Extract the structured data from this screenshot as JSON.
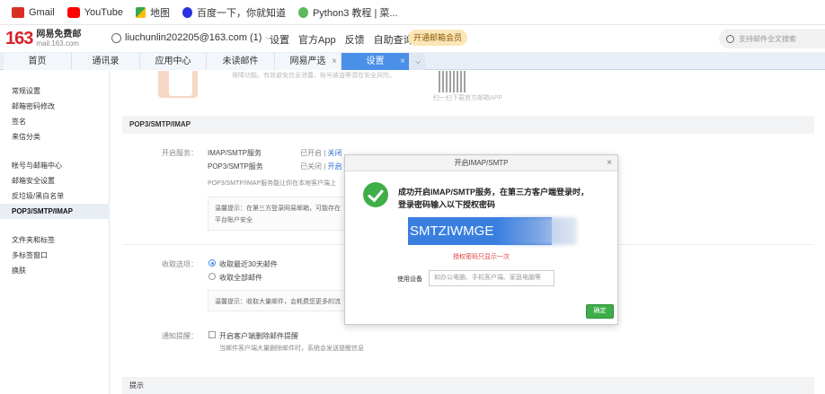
{
  "bookmarks": [
    {
      "label": "Gmail",
      "icon": "gmail-icon",
      "color": "#d93025"
    },
    {
      "label": "YouTube",
      "icon": "youtube-icon",
      "color": "#ff0000"
    },
    {
      "label": "地图",
      "icon": "maps-icon",
      "color": "#34a853"
    },
    {
      "label": "百度一下，你就知道",
      "icon": "baidu-icon",
      "color": "#2932e1"
    },
    {
      "label": "Python3 教程 | 菜...",
      "icon": "runoob-icon",
      "color": "#5cb85c"
    }
  ],
  "header": {
    "logo_number": "163",
    "logo_title": "网易免费邮",
    "logo_domain": "mail.163.com",
    "account": "liuchunlin202205@163.com (1)",
    "links": [
      "设置",
      "官方App",
      "反馈",
      "自助查询"
    ],
    "vip": "开通邮箱会员",
    "search_placeholder": "支持邮件全文搜索"
  },
  "tabs": [
    {
      "label": "首页",
      "closable": false,
      "active": false
    },
    {
      "label": "通讯录",
      "closable": false,
      "active": false
    },
    {
      "label": "应用中心",
      "closable": false,
      "active": false
    },
    {
      "label": "未读邮件",
      "closable": false,
      "active": false
    },
    {
      "label": "网易严选",
      "closable": true,
      "active": false
    },
    {
      "label": "设置",
      "closable": true,
      "active": true
    }
  ],
  "sidebar": {
    "items": [
      "常规设置",
      "邮箱密码修改",
      "签名",
      "来信分类",
      "帐号与邮箱中心",
      "邮箱安全设置",
      "反垃圾/黑白名单",
      "POP3/SMTP/IMAP",
      "文件夹和标签",
      "多标签窗口",
      "换肤"
    ],
    "active": "POP3/SMTP/IMAP"
  },
  "main": {
    "top_gray_text": "保障功能。有效避免信息泄露，账号被盗等潜在安全风险。",
    "qr_caption": "扫一扫下载官方邮箱APP",
    "section_title": "POP3/SMTP/IMAP",
    "service_label": "开启服务：",
    "services": [
      {
        "name": "IMAP/SMTP服务",
        "status": "已开启",
        "action": "关闭"
      },
      {
        "name": "POP3/SMTP服务",
        "status": "已关闭",
        "action": "开启"
      }
    ],
    "service_note": "POP3/SMTP/IMAP服务能让你在本地客户端上",
    "tip1": "温馨提示：在第三方登录网易邮箱，可能存在",
    "tip1_line2": "平台账户安全",
    "receive_label": "收取选项：",
    "receive_options": [
      "收取最近30天邮件",
      "收取全部邮件"
    ],
    "tip2": "温馨提示：收取大量邮件，会耗费您更多的流",
    "notify_label": "通知提醒：",
    "notify_option": "开启客户端删除邮件提醒",
    "notify_note": "当邮件客户端大量删除邮件时，系统会发送提醒信息",
    "bottom_section": "提示"
  },
  "dialog": {
    "title": "开启IMAP/SMTP",
    "message": "成功开启IMAP/SMTP服务，在第三方客户端登录时，登录密码输入以下授权密码",
    "code": "SMTZIWMGE",
    "code_note": "授权密码只显示一次",
    "use_label": "使用设备",
    "use_placeholder": "如办公电脑、手机客户端、家庭电脑等",
    "confirm": "确定"
  },
  "colors": {
    "accent": "#4a8fe8",
    "success": "#3fae49",
    "warning": "#e23b3b",
    "brand": "#d8222b"
  }
}
